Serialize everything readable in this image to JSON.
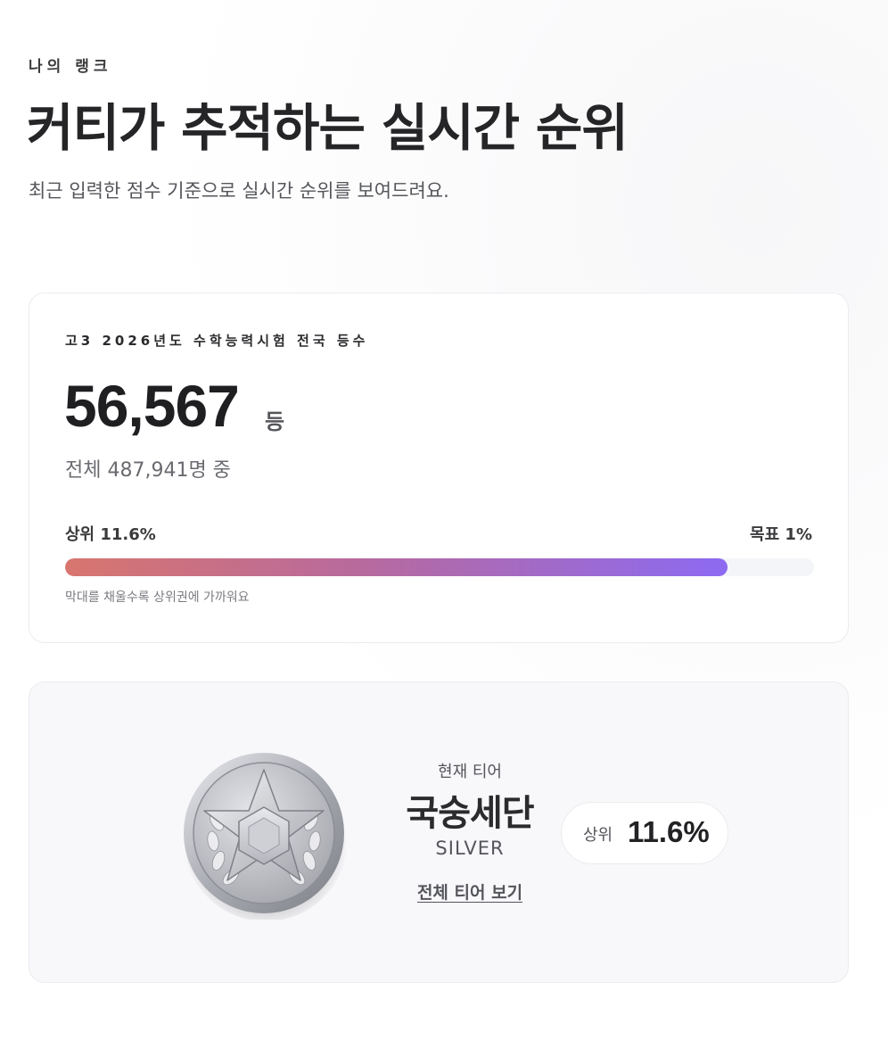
{
  "header": {
    "eyebrow": "나의 랭크",
    "title": "커티가 추적하는 실시간 순위",
    "subtitle": "최근 입력한 점수 기준으로 실시간 순위를 보여드려요."
  },
  "rank_card": {
    "exam_label": "고3 2026년도 수학능력시험 전국 등수",
    "rank": "56,567",
    "rank_unit": "등",
    "total_text": "전체 487,941명 중",
    "progress": {
      "left_label": "상위 11.6%",
      "right_label": "목표 1%",
      "fill_fraction": 0.885,
      "gradient_start": "#d8756e",
      "gradient_end": "#8c6af2",
      "hint": "막대를 채울수록 상위권에 가까워요"
    }
  },
  "tier_card": {
    "medal_icon": "silver-star-medal",
    "caption": "현재 티어",
    "tier_name": "국숭세단",
    "tier_en": "SILVER",
    "link_label": "전체 티어 보기",
    "pill": {
      "label": "상위",
      "value": "11.6%"
    }
  }
}
